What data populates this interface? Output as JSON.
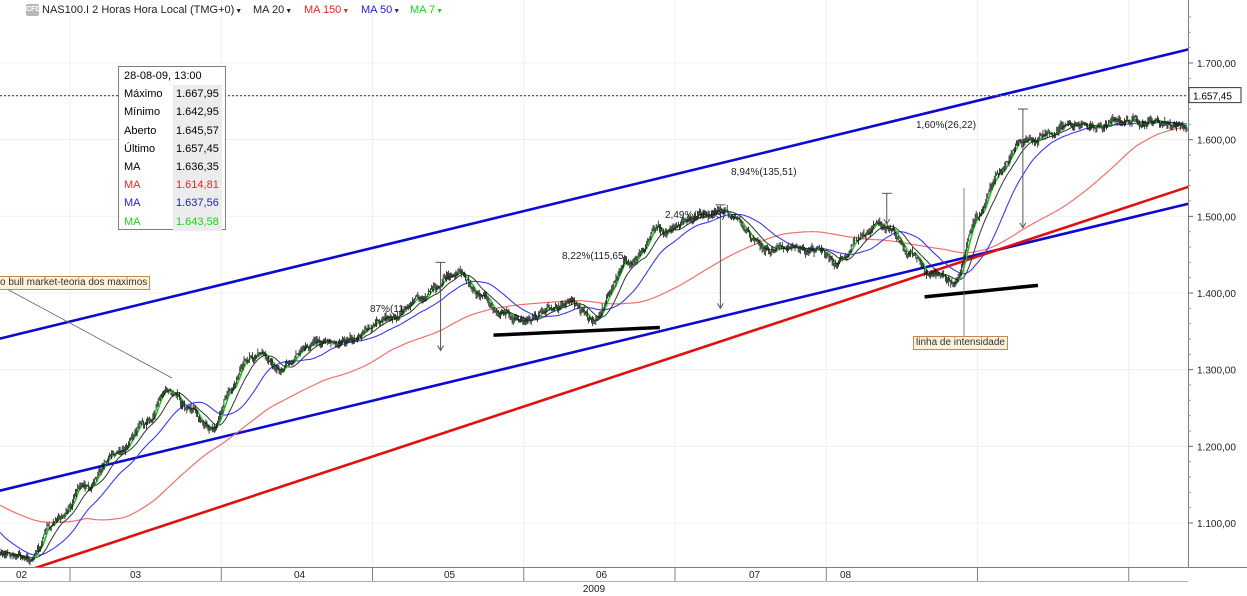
{
  "header": {
    "logo": "CFD",
    "symbol": "NAS100.I 2 Horas Hora Local (TMG+0)",
    "indicators": [
      {
        "label": "MA 20",
        "color": "#222222"
      },
      {
        "label": "MA 150",
        "color": "#ee2222"
      },
      {
        "label": "MA 50",
        "color": "#2222cc"
      },
      {
        "label": "MA 7",
        "color": "#22cc22"
      }
    ]
  },
  "info_box": {
    "date": "28-08-09, 13:00",
    "rows": [
      {
        "label": "Máximo",
        "value": "1.667,95",
        "color": "#000000"
      },
      {
        "label": "Mínimo",
        "value": "1.642,95",
        "color": "#000000"
      },
      {
        "label": "Aberto",
        "value": "1.645,57",
        "color": "#000000"
      },
      {
        "label": "Último",
        "value": "1.657,45",
        "color": "#000000"
      },
      {
        "label": "MA",
        "value": "1.636,35",
        "color": "#000000"
      },
      {
        "label": "MA",
        "value": "1.614,81",
        "color": "#ee2222"
      },
      {
        "label": "MA",
        "value": "1.637,56",
        "color": "#2222cc"
      },
      {
        "label": "MA",
        "value": "1.643,58",
        "color": "#22cc22"
      }
    ]
  },
  "annotations": {
    "bull_market": "o bull market-teoria dos maximos",
    "intensity": "linha de intensidade",
    "pct_labels": [
      "87%(11",
      "8,22%(115,65",
      "2,49%(38,03)",
      "8,94%(135,51)",
      "1,60%(26,22)"
    ]
  },
  "chart_data": {
    "type": "candlestick",
    "title": "NAS100.I 2 Horas Hora Local (TMG+0)",
    "year_label": "2009",
    "x_ticks": [
      "02",
      "03",
      "04",
      "05",
      "06",
      "07",
      "08"
    ],
    "y_ticks": [
      "1.100,00",
      "1.200,00",
      "1.300,00",
      "1.400,00",
      "1.500,00",
      "1.600,00",
      "1.700,00"
    ],
    "y_tick_values": [
      1100,
      1200,
      1300,
      1400,
      1500,
      1600,
      1700
    ],
    "ylim": [
      1040,
      1775
    ],
    "last_price": "1.657,45",
    "last_price_value": 1657.45,
    "close_path": [
      [
        0,
        1180
      ],
      [
        0.18,
        1165
      ],
      [
        0.3,
        1100
      ],
      [
        0.55,
        1060
      ],
      [
        0.72,
        1050
      ],
      [
        0.9,
        1100
      ],
      [
        1.1,
        1150
      ],
      [
        1.3,
        1190
      ],
      [
        1.5,
        1230
      ],
      [
        1.65,
        1270
      ],
      [
        1.8,
        1245
      ],
      [
        1.95,
        1225
      ],
      [
        2.05,
        1270
      ],
      [
        2.2,
        1320
      ],
      [
        2.4,
        1300
      ],
      [
        2.6,
        1340
      ],
      [
        2.85,
        1340
      ],
      [
        3.05,
        1360
      ],
      [
        3.3,
        1390
      ],
      [
        3.55,
        1430
      ],
      [
        3.7,
        1400
      ],
      [
        3.85,
        1370
      ],
      [
        4.0,
        1365
      ],
      [
        4.2,
        1375
      ],
      [
        4.3,
        1385
      ],
      [
        4.45,
        1365
      ],
      [
        4.7,
        1440
      ],
      [
        4.9,
        1480
      ],
      [
        5.1,
        1500
      ],
      [
        5.3,
        1510
      ],
      [
        5.45,
        1490
      ],
      [
        5.6,
        1460
      ],
      [
        5.75,
        1460
      ],
      [
        5.95,
        1455
      ],
      [
        6.05,
        1440
      ],
      [
        6.25,
        1480
      ],
      [
        6.4,
        1485
      ],
      [
        6.55,
        1450
      ],
      [
        6.7,
        1425
      ],
      [
        6.85,
        1415
      ],
      [
        7.0,
        1500
      ],
      [
        7.15,
        1560
      ],
      [
        7.3,
        1600
      ],
      [
        7.5,
        1610
      ],
      [
        7.65,
        1620
      ],
      [
        7.8,
        1615
      ],
      [
        7.95,
        1625
      ],
      [
        8.15,
        1625
      ],
      [
        8.35,
        1620
      ],
      [
        8.5,
        1580
      ],
      [
        8.6,
        1575
      ],
      [
        8.75,
        1600
      ],
      [
        8.85,
        1625
      ],
      [
        8.95,
        1645
      ],
      [
        9.1,
        1657
      ]
    ],
    "ma_periods": {
      "green": 7,
      "black": 20,
      "blue": 50,
      "red": 150
    },
    "trend_lines": [
      {
        "name": "channel-upper",
        "color": "#0a0ad2",
        "p1": [
          -0.35,
          1298
        ],
        "p2": [
          9.65,
          1778
        ]
      },
      {
        "name": "channel-lower",
        "color": "#0a0ad2",
        "p1": [
          -0.35,
          1100
        ],
        "p2": [
          10.15,
          1600
        ]
      },
      {
        "name": "red-support",
        "color": "#e01010",
        "p1": [
          0.75,
          1040
        ],
        "p2": [
          10.15,
          1653
        ]
      }
    ],
    "support_lines": [
      {
        "p1": [
          3.8,
          1345
        ],
        "p2": [
          4.9,
          1355
        ]
      },
      {
        "p1": [
          6.65,
          1395
        ],
        "p2": [
          7.4,
          1410
        ]
      },
      {
        "p1": [
          8.55,
          1565
        ],
        "p2": [
          9.1,
          1570
        ]
      }
    ],
    "measure_arrows": [
      {
        "x": 3.45,
        "top": 1440,
        "bottom": 1325
      },
      {
        "x": 5.3,
        "top": 1515,
        "bottom": 1380
      },
      {
        "x": 6.4,
        "top": 1530,
        "bottom": 1490
      },
      {
        "x": 7.3,
        "top": 1640,
        "bottom": 1485
      },
      {
        "x": 8.9,
        "top": 1640,
        "bottom": 1610
      }
    ]
  }
}
